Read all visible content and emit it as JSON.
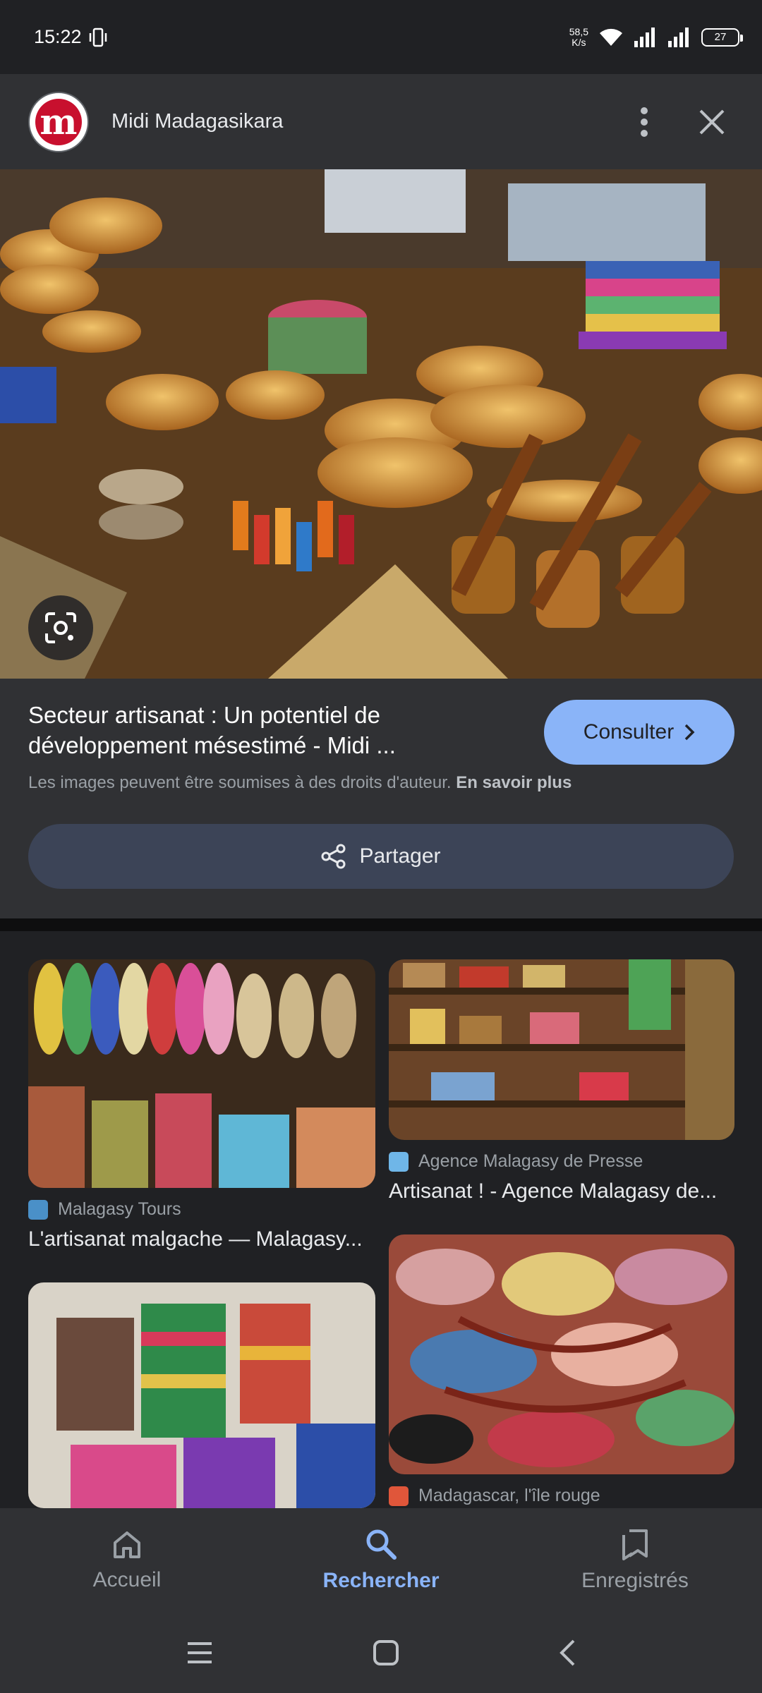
{
  "status_bar": {
    "time": "15:22",
    "net_speed_value": "58,5",
    "net_speed_unit": "K/s",
    "battery": "27"
  },
  "header": {
    "logo_letter": "m",
    "site_name": "Midi Madagasikara"
  },
  "article": {
    "title": "Secteur artisanat : Un potentiel de développement mésestimé - Midi ...",
    "consult_label": "Consulter",
    "copyright_text": "Les images peuvent être soumises à des droits d'auteur.",
    "learn_more": "En savoir plus",
    "share_label": "Partager"
  },
  "results": [
    {
      "source": "Malagasy Tours",
      "title": "L'artisanat malgache — Malagasy..."
    },
    {
      "source": "Agence Malagasy de Presse",
      "title": "Artisanat ! - Agence Malagasy de..."
    },
    {
      "source": "Madagascar, l'île rouge",
      "title": ""
    }
  ],
  "bottom_nav": [
    {
      "label": "Accueil",
      "icon": "home-icon"
    },
    {
      "label": "Rechercher",
      "icon": "search-icon"
    },
    {
      "label": "Enregistrés",
      "icon": "bookmarks-icon"
    }
  ],
  "colors": {
    "background": "#202124",
    "surface": "#303134",
    "accent": "#8ab4f8",
    "share_button": "#3c4457"
  }
}
